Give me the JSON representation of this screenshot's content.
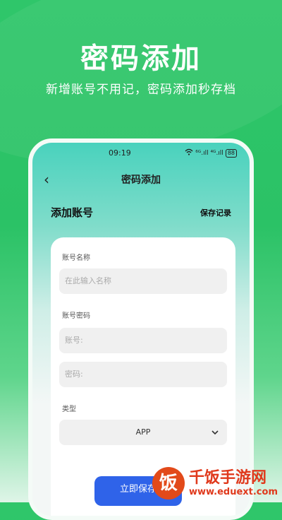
{
  "hero": {
    "title": "密码添加",
    "subtitle": "新增账号不用记，密码添加秒存档"
  },
  "status": {
    "time": "09:19",
    "signal": "⁶ᴳ.ıll ⁴ᴳ.ıll",
    "battery": "88"
  },
  "nav": {
    "back": "‹",
    "title": "密码添加"
  },
  "page": {
    "title": "添加账号",
    "record_label": "保存记录"
  },
  "form": {
    "name_label": "账号名称",
    "name_placeholder": "在此输入名称",
    "pwd_section_label": "账号密码",
    "account_placeholder": "账号:",
    "password_placeholder": "密码:",
    "type_label": "类型",
    "type_value": "APP"
  },
  "save_label": "立即保存",
  "watermark": {
    "logo_char": "饭",
    "name": "千饭手游网",
    "url": "www.eduext.com"
  },
  "colors": {
    "bg_green": "#2fc66a",
    "teal": "#49d2bd",
    "button_blue": "#2f63e9",
    "watermark_red": "#e0391c"
  }
}
